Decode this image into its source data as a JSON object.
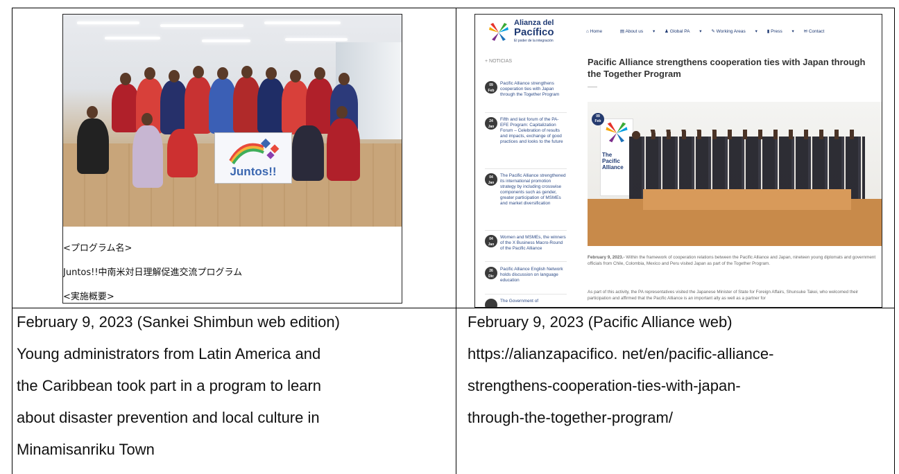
{
  "left_panel": {
    "banner_text": "Juntos!!",
    "caption_lines": [
      "<プログラム名>",
      "Juntos!!中南米対日理解促進交流プログラム",
      "<実施概要>"
    ]
  },
  "right_panel": {
    "logo": {
      "line1": "Alianza del",
      "line2": "Pacífico",
      "tagline": "El poder de la integración"
    },
    "nav": [
      "Home",
      "About us",
      "Global PA",
      "Working Areas",
      "Press",
      "Contact"
    ],
    "sidebar_heading": "+ NOTICIAS",
    "sidebar_items": [
      {
        "day": "09",
        "month": "Feb",
        "text": "Pacific Alliance strengthens cooperation ties with Japan through the Together Program"
      },
      {
        "day": "24",
        "month": "Jan",
        "text": "Fifth and last forum of the PA-EFE Program: Capitalization Forum – Celebration of results and impacts, exchange of good practices and looks to the future"
      },
      {
        "day": "04",
        "month": "Jan",
        "text": "The Pacific Alliance strengthened its international promotion strategy by including crosswise components such as gender, greater participation of MSMEs and market diversification"
      },
      {
        "day": "04",
        "month": "Jan",
        "text": "Women and MSMEs, the winners of the X Business Macro-Round of the Pacific Alliance"
      },
      {
        "day": "26",
        "month": "Dic",
        "text": "Pacific Alliance English Network holds discussion on language education"
      },
      {
        "day": "",
        "month": "",
        "text": "The Government of"
      }
    ],
    "article_title": "Pacific Alliance strengthens cooperation ties with Japan through the Together Program",
    "image_badge": {
      "day": "09",
      "month": "Feb"
    },
    "image_backdrop": "The Pacific Alliance",
    "paragraph1_date": "February 9, 2023.-",
    "paragraph1": " Within the framework of cooperation relations between the Pacific Alliance and Japan, nineteen young diplomats and government officials from Chile, Colombia, Mexico and Peru visited Japan as part of the Together Program.",
    "paragraph2": "As part of this activity, the PA representatives visited the Japanese Minister of State for Foreign Affairs, Shunsuke Takei, who welcomed their participation and affirmed that the Pacific Alliance is an important ally as well as a partner for"
  },
  "captions": {
    "left": [
      "February 9, 2023 (Sankei Shimbun web edition)",
      "Young administrators from Latin America and",
      "the Caribbean took part in a program to learn",
      "about disaster prevention and local culture in",
      "Minamisanriku Town"
    ],
    "right": [
      "February 9, 2023 (Pacific Alliance web)",
      "https://alianzapacifico. net/en/pacific-alliance-",
      "strengthens-cooperation-ties-with-japan-",
      "through-the-together-program/"
    ]
  }
}
